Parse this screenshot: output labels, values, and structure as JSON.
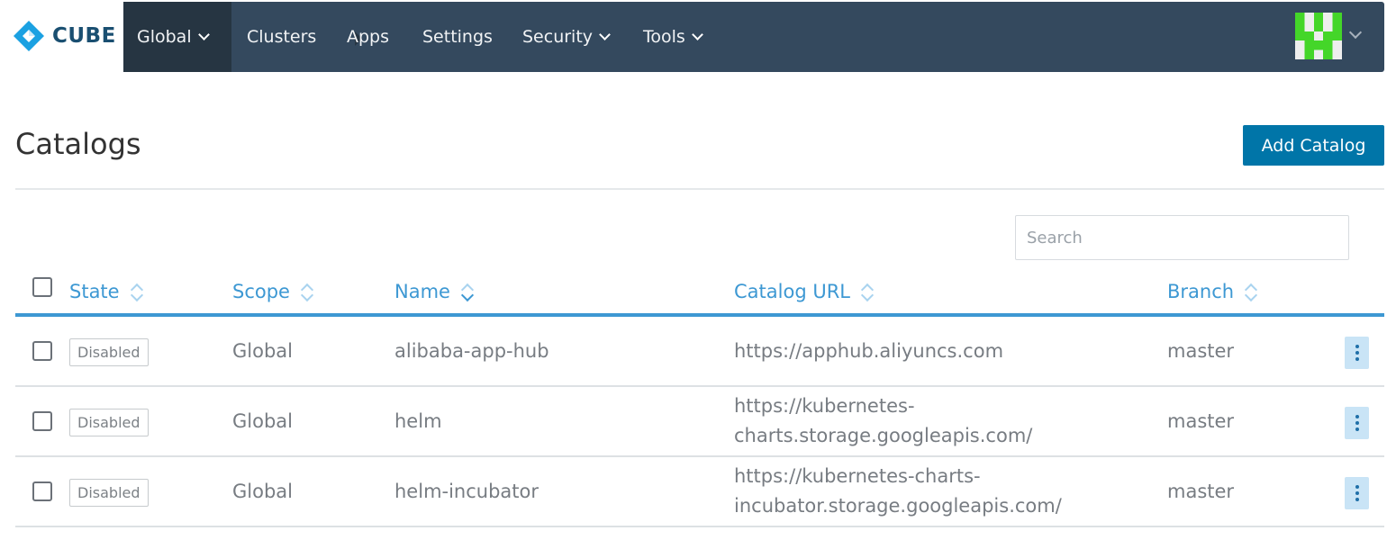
{
  "brand": {
    "name": "CUBE"
  },
  "nav": {
    "items": [
      {
        "label": "Global",
        "has_dropdown": true,
        "active": true
      },
      {
        "label": "Clusters",
        "has_dropdown": false
      },
      {
        "label": "Apps",
        "has_dropdown": false
      },
      {
        "label": "Settings",
        "has_dropdown": false
      },
      {
        "label": "Security",
        "has_dropdown": true
      },
      {
        "label": "Tools",
        "has_dropdown": true
      }
    ],
    "user_icon": "user-avatar-icon"
  },
  "page": {
    "title": "Catalogs",
    "add_button": "Add Catalog"
  },
  "search": {
    "placeholder": "Search",
    "value": ""
  },
  "table": {
    "columns": [
      "State",
      "Scope",
      "Name",
      "Catalog URL",
      "Branch"
    ],
    "sorted_column": "Name",
    "rows": [
      {
        "state": "Disabled",
        "scope": "Global",
        "name": "alibaba-app-hub",
        "url_line1": "https://apphub.aliyuncs.com",
        "url_line2": "",
        "branch": "master"
      },
      {
        "state": "Disabled",
        "scope": "Global",
        "name": "helm",
        "url_line1": "https://kubernetes-",
        "url_line2": "charts.storage.googleapis.com/",
        "branch": "master"
      },
      {
        "state": "Disabled",
        "scope": "Global",
        "name": "helm-incubator",
        "url_line1": "https://kubernetes-charts-",
        "url_line2": "incubator.storage.googleapis.com/",
        "branch": "master"
      }
    ]
  },
  "colors": {
    "nav_bg": "#34495e",
    "nav_active_bg": "#263542",
    "accent": "#3d98d3",
    "primary_button": "#0075a8",
    "brand_logo": "#1ba1e2"
  }
}
